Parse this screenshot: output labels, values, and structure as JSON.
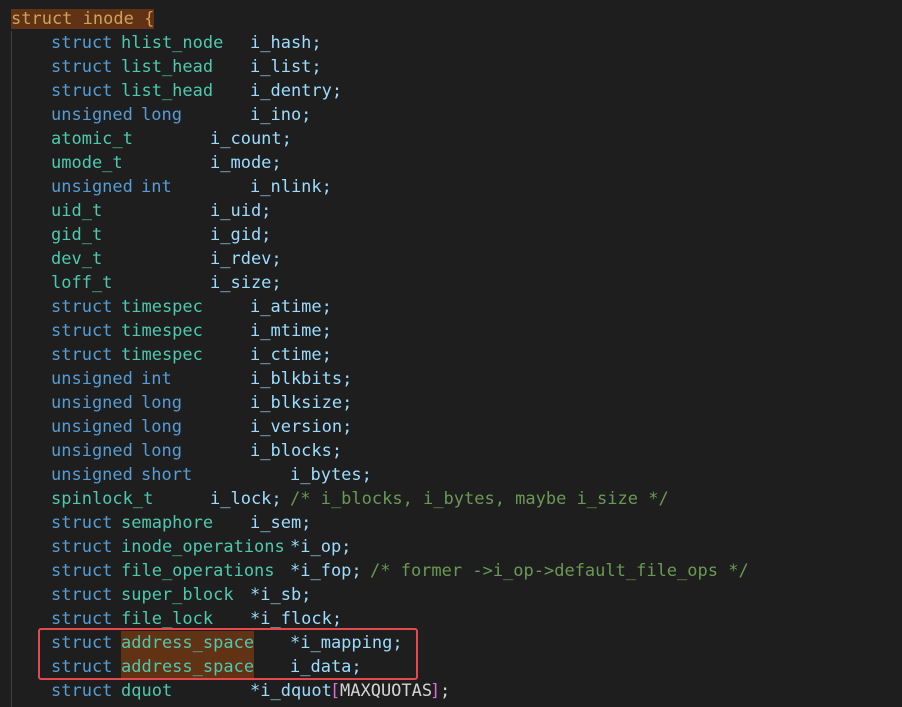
{
  "code": {
    "header": {
      "kw": "struct",
      "name": "inode",
      "brace": "{"
    },
    "lines": [
      {
        "t1": "struct",
        "t2": "hlist_node",
        "field": "i_hash;",
        "comment": ""
      },
      {
        "t1": "struct",
        "t2": "list_head",
        "field": "i_list;",
        "comment": ""
      },
      {
        "t1": "struct",
        "t2": "list_head",
        "field": "i_dentry;",
        "comment": ""
      },
      {
        "t1": "unsigned",
        "t2": "long",
        "field": "i_ino;",
        "comment": ""
      },
      {
        "t1": "",
        "t2": "atomic_t",
        "field": "i_count;",
        "comment": ""
      },
      {
        "t1": "",
        "t2": "umode_t",
        "field": "i_mode;",
        "comment": ""
      },
      {
        "t1": "unsigned",
        "t2": "int",
        "field": "i_nlink;",
        "comment": ""
      },
      {
        "t1": "",
        "t2": "uid_t",
        "field": "i_uid;",
        "comment": ""
      },
      {
        "t1": "",
        "t2": "gid_t",
        "field": "i_gid;",
        "comment": ""
      },
      {
        "t1": "",
        "t2": "dev_t",
        "field": "i_rdev;",
        "comment": ""
      },
      {
        "t1": "",
        "t2": "loff_t",
        "field": "i_size;",
        "comment": ""
      },
      {
        "t1": "struct",
        "t2": "timespec",
        "field": "i_atime;",
        "comment": ""
      },
      {
        "t1": "struct",
        "t2": "timespec",
        "field": "i_mtime;",
        "comment": ""
      },
      {
        "t1": "struct",
        "t2": "timespec",
        "field": "i_ctime;",
        "comment": ""
      },
      {
        "t1": "unsigned",
        "t2": "int",
        "field": "i_blkbits;",
        "comment": ""
      },
      {
        "t1": "unsigned",
        "t2": "long",
        "field": "i_blksize;",
        "comment": ""
      },
      {
        "t1": "unsigned",
        "t2": "long",
        "field": "i_version;",
        "comment": ""
      },
      {
        "t1": "unsigned",
        "t2": "long",
        "field": "i_blocks;",
        "comment": ""
      },
      {
        "t1": "unsigned",
        "t2": "short",
        "field": "i_bytes;",
        "comment": ""
      },
      {
        "t1": "",
        "t2": "spinlock_t",
        "field": "i_lock;",
        "comment": "/* i_blocks, i_bytes, maybe i_size */"
      },
      {
        "t1": "struct",
        "t2": "semaphore",
        "field": "i_sem;",
        "comment": ""
      },
      {
        "t1": "struct",
        "t2": "inode_operations",
        "field": "*i_op;",
        "comment": ""
      },
      {
        "t1": "struct",
        "t2": "file_operations",
        "field": "*i_fop;",
        "comment": "/* former ->i_op->default_file_ops */"
      },
      {
        "t1": "struct",
        "t2": "super_block",
        "field": "*i_sb;",
        "comment": ""
      },
      {
        "t1": "struct",
        "t2": "file_lock",
        "field": "*i_flock;",
        "comment": ""
      },
      {
        "t1": "struct",
        "t2": "address_space",
        "field": "*i_mapping;",
        "comment": ""
      },
      {
        "t1": "struct",
        "t2": "address_space",
        "field": "i_data;",
        "comment": ""
      },
      {
        "t1": "struct",
        "t2": "dquot",
        "field": "*i_dquot",
        "bracket_open": "[",
        "macro": "MAXQUOTAS",
        "bracket_close": "]",
        "tail": ";",
        "comment": ""
      }
    ]
  },
  "colors": {
    "keyword": "#569cd6",
    "type": "#4ec9b0",
    "identifier": "#9cdcfe",
    "comment": "#6a9955",
    "highlight": "#613214",
    "annotation_box": "#e5484d"
  }
}
